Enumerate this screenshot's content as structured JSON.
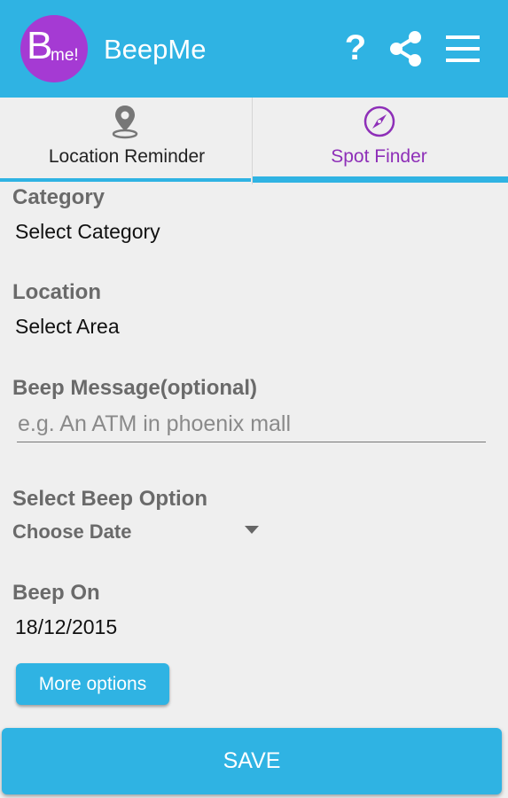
{
  "app": {
    "logo": {
      "big": "B",
      "small": "me!"
    },
    "title": "BeepMe",
    "help_symbol": "?",
    "icons": [
      "help-icon",
      "share-icon",
      "menu-icon"
    ],
    "accent_color": "#2fb3e3",
    "logo_color": "#a53ad3"
  },
  "tabs": [
    {
      "label": "Location Reminder",
      "icon": "location-pin-icon",
      "active": false
    },
    {
      "label": "Spot Finder",
      "icon": "compass-icon",
      "active": true,
      "color": "#8e2fb8"
    }
  ],
  "form": {
    "category": {
      "label": "Category",
      "value": "Select Category"
    },
    "location": {
      "label": "Location",
      "value": "Select Area"
    },
    "message": {
      "label": "Beep Message(optional)",
      "value": "",
      "placeholder": "e.g. An ATM in phoenix mall"
    },
    "beep_option": {
      "label": "Select Beep Option",
      "selected": "Choose Date"
    },
    "beep_on": {
      "label": "Beep On",
      "value": "18/12/2015"
    }
  },
  "buttons": {
    "more_options": "More options",
    "save": "SAVE"
  }
}
